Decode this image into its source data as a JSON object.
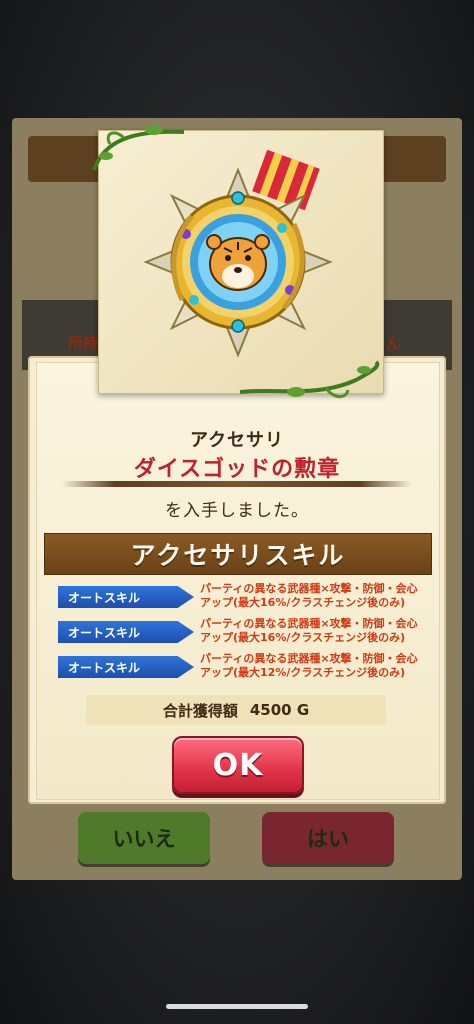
{
  "background": {
    "under_label_left": "所持",
    "under_label_right": "ん",
    "no_button_label": "いいえ",
    "yes_button_label": "はい"
  },
  "reward": {
    "category": "アクセサリ",
    "item_name": "ダイスゴッドの勲章",
    "obtained_text": "を入手しました。",
    "item_icon": "tiger-medal-icon"
  },
  "skills": {
    "header": "アクセサリスキル",
    "items": [
      {
        "tag": "オートスキル",
        "description": "パーティの異なる武器種×攻撃・防御・会心\nアップ(最大16%/クラスチェンジ後のみ)"
      },
      {
        "tag": "オートスキル",
        "description": "パーティの異なる武器種×攻撃・防御・会心\nアップ(最大16%/クラスチェンジ後のみ)"
      },
      {
        "tag": "オートスキル",
        "description": "パーティの異なる武器種×攻撃・防御・会心\nアップ(最大12%/クラスチェンジ後のみ)"
      }
    ]
  },
  "total": {
    "label": "合計獲得額",
    "value": "4500 G"
  },
  "ok_button_label": "OK",
  "colors": {
    "item_name": "#c0202c",
    "skill_tag": "#2f74d8",
    "skill_desc": "#d23a14",
    "ok_button": "#e23448"
  }
}
